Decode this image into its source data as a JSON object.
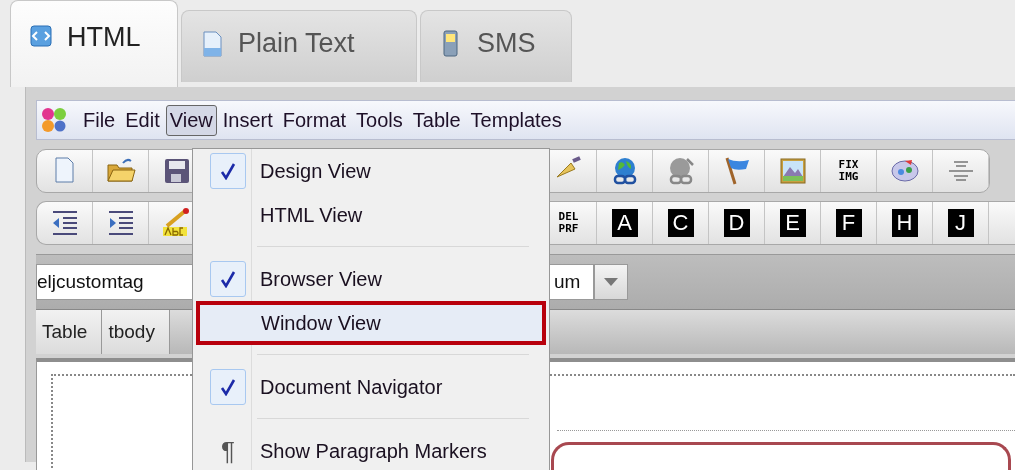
{
  "tabs": [
    {
      "label": "HTML",
      "selected": true
    },
    {
      "label": "Plain Text",
      "selected": false
    },
    {
      "label": "SMS",
      "selected": false
    }
  ],
  "menu_bar": [
    {
      "label": "File",
      "selected": false
    },
    {
      "label": "Edit",
      "selected": false
    },
    {
      "label": "View",
      "selected": true
    },
    {
      "label": "Insert",
      "selected": false
    },
    {
      "label": "Format",
      "selected": false
    },
    {
      "label": "Tools",
      "selected": false
    },
    {
      "label": "Table",
      "selected": false
    },
    {
      "label": "Templates",
      "selected": false
    }
  ],
  "toolbar_1": {
    "text_button": "FIX IMG"
  },
  "toolbar_2": {
    "text_button": "DEL PRF",
    "letter_buttons": [
      "A",
      "C",
      "D",
      "E",
      "F",
      "H",
      "J"
    ]
  },
  "style_bar": {
    "tag_field": "eljcustomtag",
    "size_field": "um"
  },
  "breadcrumb": [
    "Table",
    "tbody"
  ],
  "view_menu": [
    {
      "kind": "item",
      "label": "Design View",
      "checked": true,
      "selected": false
    },
    {
      "kind": "item",
      "label": "HTML View",
      "checked": false,
      "selected": false
    },
    {
      "kind": "separator"
    },
    {
      "kind": "item",
      "label": "Browser View",
      "checked": true,
      "selected": false
    },
    {
      "kind": "item",
      "label": "Window View",
      "checked": false,
      "selected": true
    },
    {
      "kind": "separator"
    },
    {
      "kind": "item",
      "label": "Document Navigator",
      "checked": true,
      "selected": false
    },
    {
      "kind": "separator"
    },
    {
      "kind": "item",
      "label": "Show Paragraph Markers",
      "checked": false,
      "selected": false,
      "icon": "¶"
    }
  ]
}
